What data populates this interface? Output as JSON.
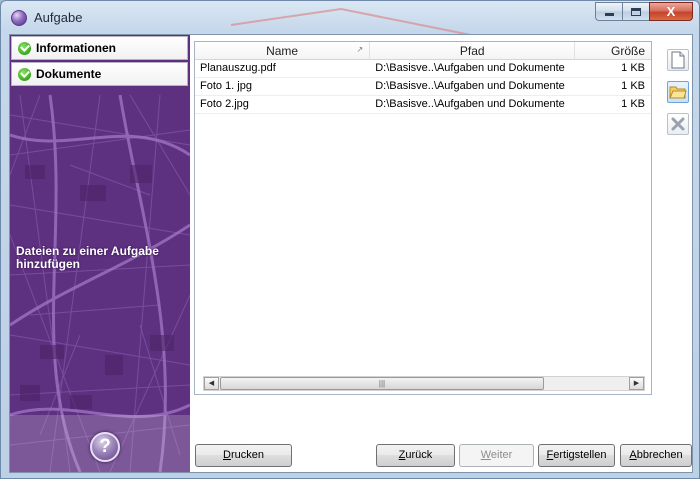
{
  "window": {
    "title": "Aufgabe",
    "caption_close": "X"
  },
  "sidebar": {
    "steps": [
      {
        "label": "Informationen",
        "status": "complete"
      },
      {
        "label": "Dokumente",
        "status": "complete"
      }
    ],
    "description": "Dateien zu einer Aufgabe hinzufügen",
    "help_label": "?"
  },
  "files": {
    "columns": [
      {
        "label": "Name"
      },
      {
        "label": "Pfad"
      },
      {
        "label": "Größe"
      }
    ],
    "rows": [
      {
        "name": "Planauszug.pdf",
        "path": "D:\\Basisve..\\Aufgaben und Dokumente",
        "size": "1 KB"
      },
      {
        "name": "Foto 1. jpg",
        "path": "D:\\Basisve..\\Aufgaben und Dokumente",
        "size": "1 KB"
      },
      {
        "name": "Foto 2.jpg",
        "path": "D:\\Basisve..\\Aufgaben und Dokumente",
        "size": "1 KB"
      }
    ]
  },
  "tools": [
    {
      "icon": "new-document-icon"
    },
    {
      "icon": "open-folder-icon"
    },
    {
      "icon": "delete-x-icon"
    }
  ],
  "buttons": {
    "print": {
      "first": "D",
      "rest": "rucken"
    },
    "back": {
      "first": "Z",
      "rest": "urück"
    },
    "next": {
      "first": "W",
      "rest": "eiter"
    },
    "finish": {
      "first": "F",
      "rest": "ertigstellen"
    },
    "cancel": {
      "first": "A",
      "rest": "bbrechen"
    }
  },
  "colors": {
    "accent_purple": "#5b2e7c",
    "check_green": "#3aa61f",
    "close_red": "#c4432b"
  }
}
